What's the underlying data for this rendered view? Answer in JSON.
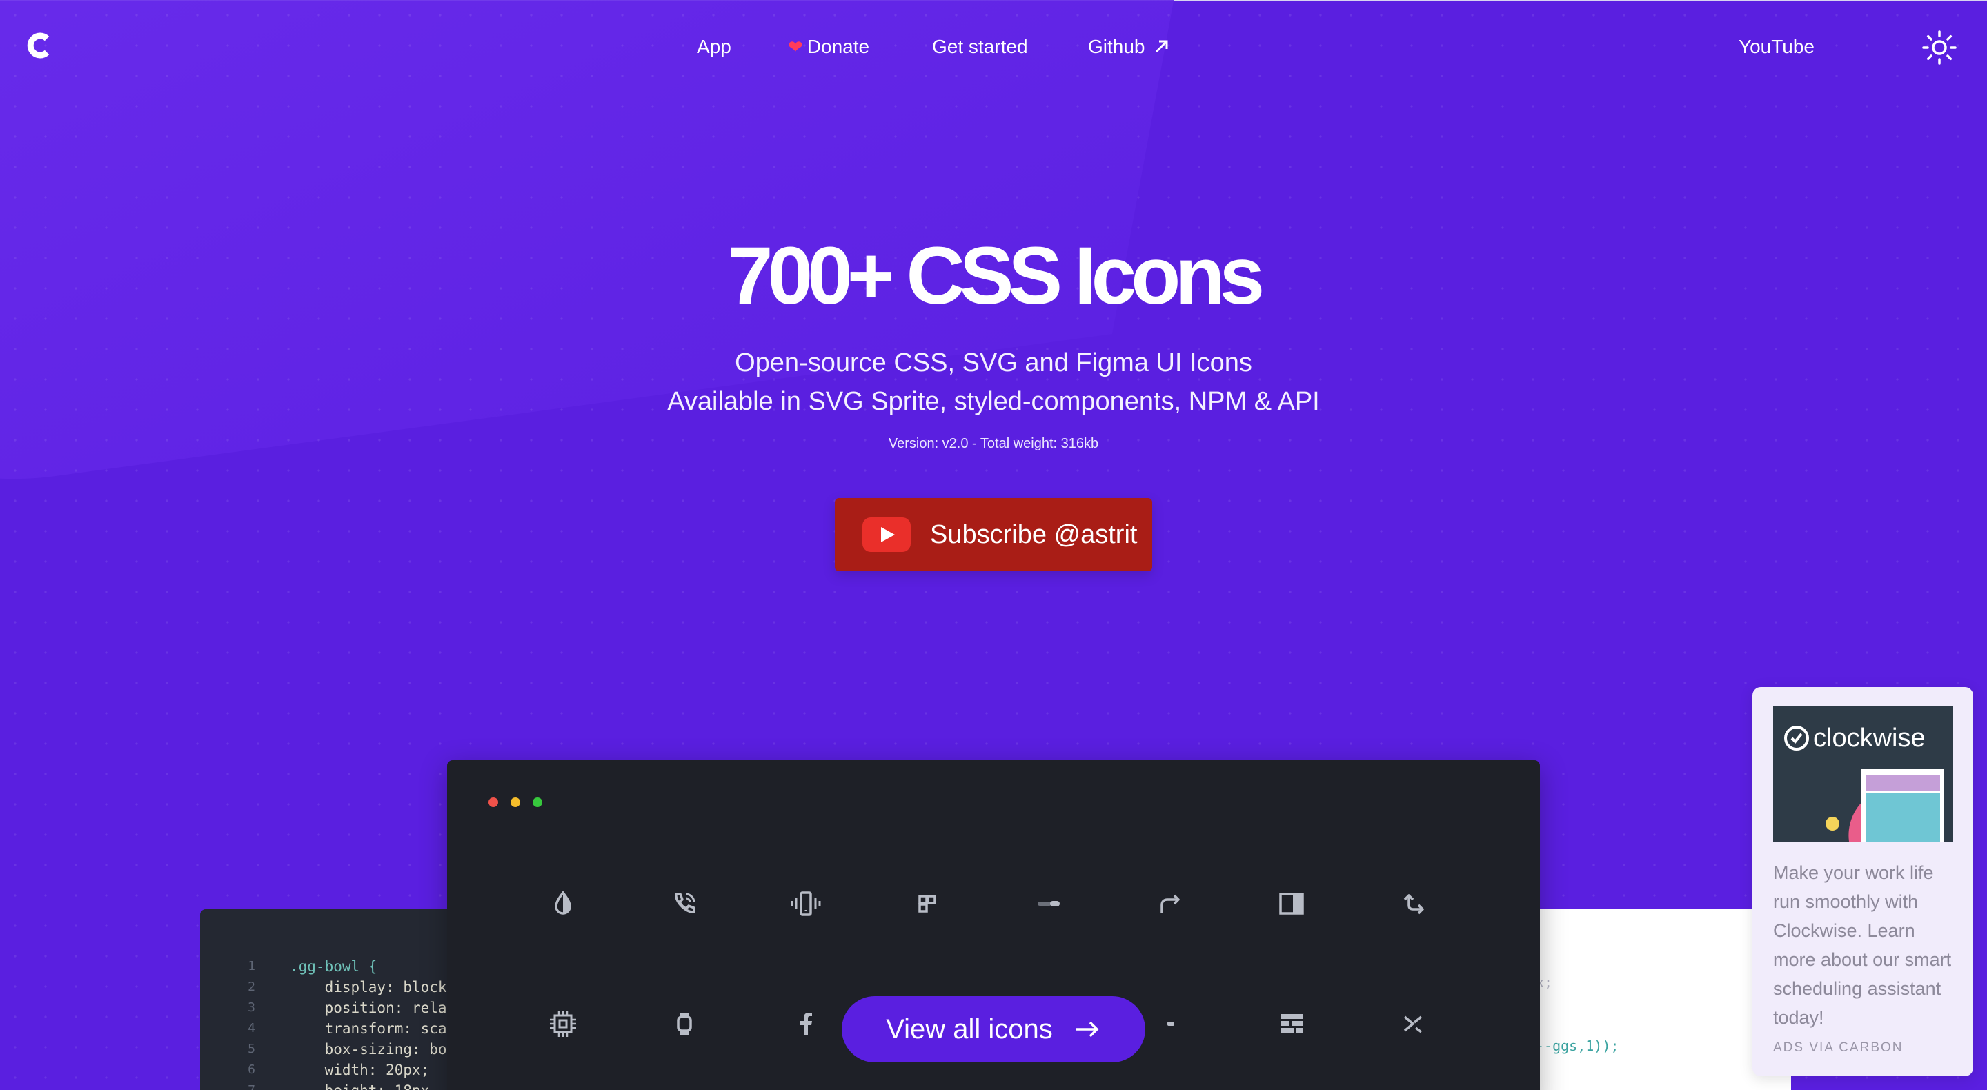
{
  "nav": {
    "app": "App",
    "donate_icon": "❤",
    "donate": "Donate",
    "get_started": "Get started",
    "github": "Github",
    "youtube": "YouTube"
  },
  "hero": {
    "title": "700+ CSS Icons",
    "subtitle_1": "Open-source CSS, SVG and Figma UI Icons",
    "subtitle_2": "Available in SVG Sprite, styled-components, NPM & API",
    "version": "Version: v2.0 - Total weight: 316kb",
    "subscribe_label": "Subscribe @astrit"
  },
  "code_left": {
    "lines": [
      {
        "n": "1",
        "text": ".gg-bowl {"
      },
      {
        "n": "2",
        "text": "    display: block"
      },
      {
        "n": "3",
        "text": "    position: rela"
      },
      {
        "n": "4",
        "text": "    transform: sca"
      },
      {
        "n": "5",
        "text": "    box-sizing: bo"
      },
      {
        "n": "6",
        "text": "    width: 20px;"
      },
      {
        "n": "7",
        "text": "    height: 18px"
      }
    ]
  },
  "code_right": {
    "line_1": "x;",
    "line_2": "--ggs,1));"
  },
  "window": {
    "icons_row_1": [
      "contrast-icon",
      "phone-call-icon",
      "smartphone-shake-icon",
      "layout-grid-small-icon",
      "toggle-off-icon",
      "redo-arrow-icon",
      "sidebar-right-icon",
      "arrow-corner-icon"
    ],
    "icons_row_2": [
      "chip-icon",
      "smartwatch-icon",
      "facebook-icon",
      "dot-small-icon",
      "layout-rows-icon",
      "shortcut-icon"
    ],
    "view_all_label": "View all icons"
  },
  "ad": {
    "brand": "clockwise",
    "text": "Make your work life run smoothly with Clockwise. Learn more about our smart scheduling assistant today!",
    "via": "ADS VIA CARBON"
  },
  "colors": {
    "background": "#5a1fe0",
    "subscribe": "#a91d16",
    "window": "#1e2027",
    "view_all": "#5a1fe0",
    "ad_bg": "#f1ecfb"
  }
}
